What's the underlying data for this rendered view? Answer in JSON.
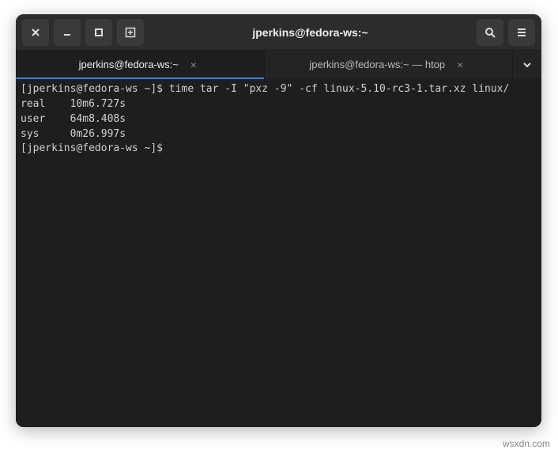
{
  "window": {
    "title": "jperkins@fedora-ws:~"
  },
  "titlebar": {
    "close_label": "close-icon",
    "minimize_label": "minimize-icon",
    "maximize_label": "maximize-icon",
    "newtab_label": "new-tab-icon",
    "search_label": "search-icon",
    "menu_label": "hamburger-icon"
  },
  "tabs": [
    {
      "label": "jperkins@fedora-ws:~",
      "active": true
    },
    {
      "label": "jperkins@fedora-ws:~ — htop",
      "active": false
    }
  ],
  "terminal": {
    "lines": [
      "[jperkins@fedora-ws ~]$ time tar -I \"pxz -9\" -cf linux-5.10-rc3-1.tar.xz linux/",
      "",
      "real    10m6.727s",
      "user    64m8.408s",
      "sys     0m26.997s",
      "[jperkins@fedora-ws ~]$ "
    ]
  },
  "watermark": "wsxdn.com"
}
